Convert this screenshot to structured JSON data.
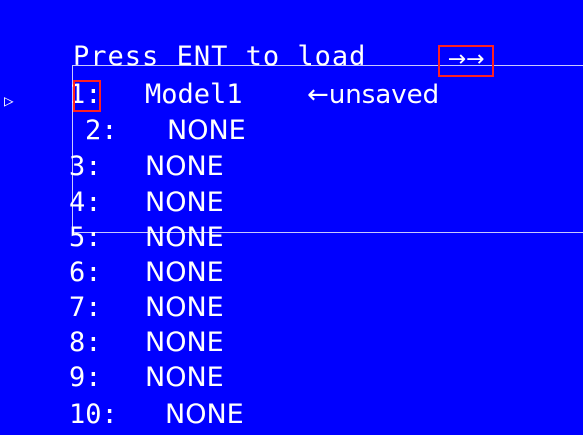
{
  "header": {
    "title": "Press ENT to load"
  },
  "slot1": {
    "number": "1:",
    "name": "Model1",
    "status": "←unsaved",
    "nav": "→→"
  },
  "cursor_glyph": "▷",
  "slots": [
    {
      "number": "2:",
      "value": "NONE"
    },
    {
      "number": "3:",
      "value": "NONE"
    },
    {
      "number": "4:",
      "value": "NONE"
    },
    {
      "number": "5:",
      "value": "NONE"
    },
    {
      "number": "6:",
      "value": "NONE"
    },
    {
      "number": "7:",
      "value": "NONE"
    },
    {
      "number": "8:",
      "value": "NONE"
    },
    {
      "number": "9:",
      "value": "NONE"
    },
    {
      "number": "10:",
      "value": "NONE"
    }
  ],
  "colors": {
    "background": "#0000ff",
    "text": "#ffffff",
    "highlight": "#ff2020",
    "overlay_line": "#c8c8ff"
  }
}
